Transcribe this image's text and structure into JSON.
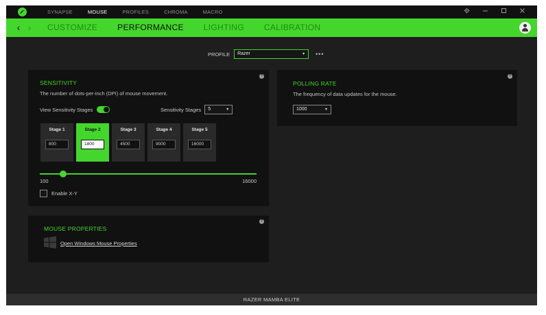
{
  "topnav": {
    "items": [
      "SYNAPSE",
      "MOUSE",
      "PROFILES",
      "CHROMA",
      "MACRO"
    ],
    "active": "MOUSE"
  },
  "window_controls": [
    "settings-icon",
    "minimize-icon",
    "maximize-icon",
    "close-icon"
  ],
  "subnav": {
    "tabs": [
      "CUSTOMIZE",
      "PERFORMANCE",
      "LIGHTING",
      "CALIBRATION"
    ],
    "active": "PERFORMANCE"
  },
  "profile": {
    "label": "PROFILE",
    "value": "Razer",
    "more": "•••"
  },
  "sensitivity": {
    "title": "SENSITIVITY",
    "description": "The number of dots-per-inch (DPI) of mouse movement.",
    "view_stages_label": "View Sensitivity Stages",
    "view_stages_on": true,
    "stages_label": "Sensitivity Stages",
    "stages_count": "5",
    "stages": [
      {
        "name": "Stage 1",
        "value": "800"
      },
      {
        "name": "Stage 2",
        "value": "1800"
      },
      {
        "name": "Stage 3",
        "value": "4500"
      },
      {
        "name": "Stage 4",
        "value": "9000"
      },
      {
        "name": "Stage 5",
        "value": "16000"
      }
    ],
    "active_stage": 2,
    "slider_min": "100",
    "slider_max": "16000",
    "slider_value": 1800,
    "enable_xy_label": "Enable X-Y",
    "enable_xy_checked": false
  },
  "polling": {
    "title": "POLLING RATE",
    "description": "The frequency of data updates for the mouse.",
    "value": "1000"
  },
  "mouse_properties": {
    "title": "MOUSE PROPERTIES",
    "link": "Open Windows Mouse Properties"
  },
  "help_glyph": "?",
  "arrows": {
    "back": "‹",
    "forward": "›"
  },
  "caret": "▾",
  "device_name": "RAZER MAMBA ELITE",
  "colors": {
    "accent": "#44d62c",
    "background": "#1e1e1e",
    "panel": "#111111"
  }
}
